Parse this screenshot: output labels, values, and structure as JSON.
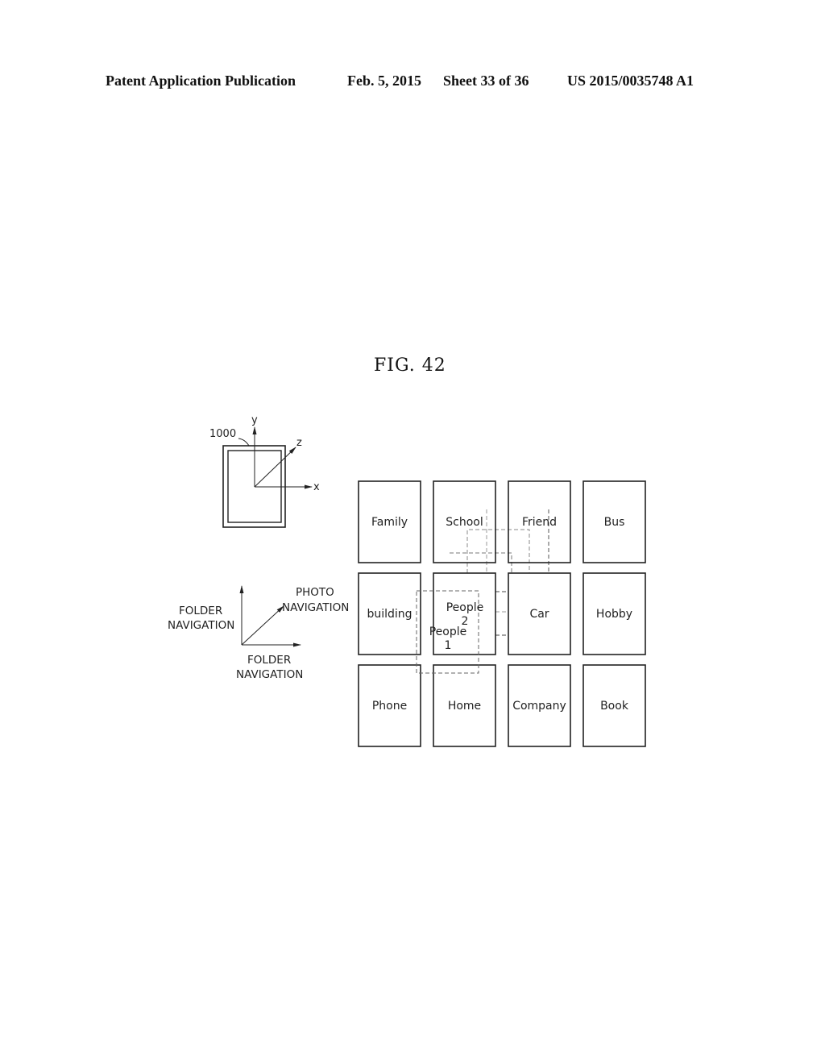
{
  "header": {
    "publication": "Patent Application Publication",
    "date": "Feb. 5, 2015",
    "sheet": "Sheet 33 of 36",
    "number": "US 2015/0035748 A1"
  },
  "figure": {
    "title": "FIG. 42",
    "device": {
      "ref": "1000",
      "axes": {
        "x": "x",
        "y": "y",
        "z": "z"
      }
    },
    "legend": {
      "vertical": [
        "FOLDER",
        "NAVIGATION"
      ],
      "horizontal": [
        "FOLDER",
        "NAVIGATION"
      ],
      "diagonal": [
        "PHOTO",
        "NAVIGATION"
      ]
    },
    "folders": [
      [
        "Family",
        "School",
        "Friend",
        "Bus"
      ],
      [
        "building",
        "People 2",
        "Car",
        "Hobby"
      ],
      [
        "Phone",
        "Home",
        "Company",
        "Book"
      ]
    ],
    "people2_label": [
      "People",
      "2"
    ],
    "people1_label": [
      "People",
      "1"
    ]
  }
}
